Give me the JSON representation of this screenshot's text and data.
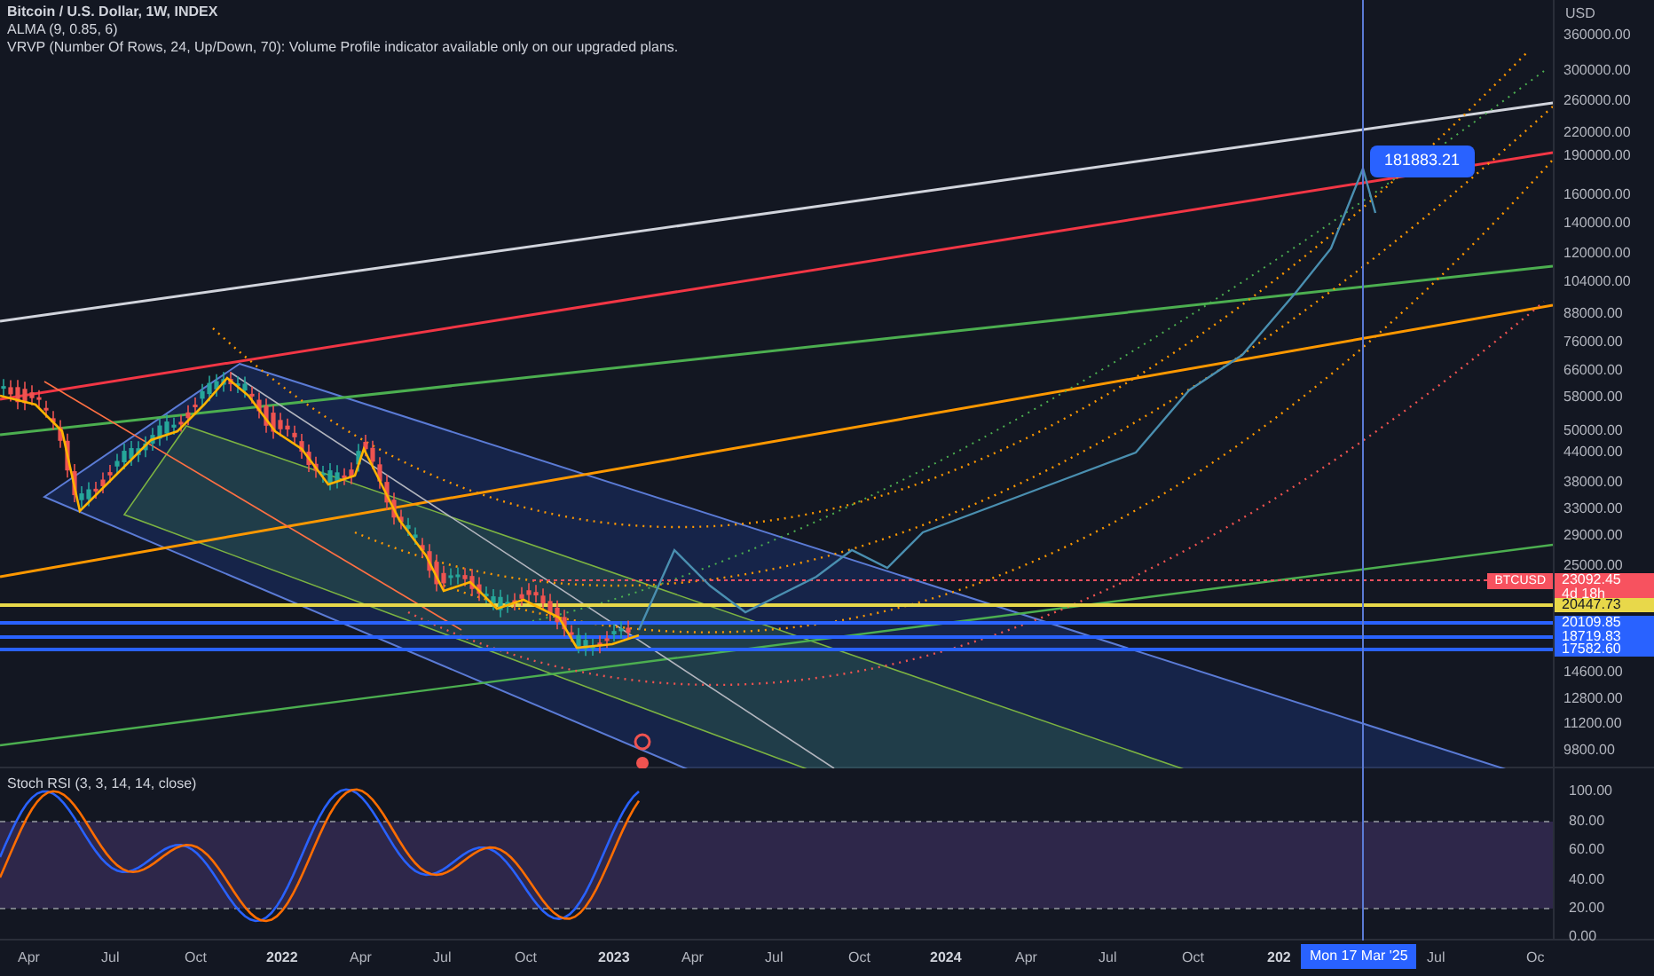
{
  "legend": {
    "symbol": "Bitcoin / U.S. Dollar, 1W, INDEX",
    "indicators": [
      "ALMA (9, 0.85, 6)",
      "VRVP (Number Of Rows, 24, Up/Down, 70): Volume Profile indicator available only on our upgraded plans."
    ]
  },
  "price_axis": {
    "currency": "USD",
    "ticks": [
      "360000.00",
      "300000.00",
      "260000.00",
      "220000.00",
      "190000.00",
      "160000.00",
      "140000.00",
      "120000.00",
      "104000.00",
      "88000.00",
      "76000.00",
      "66000.00",
      "58000.00",
      "50000.00",
      "44000.00",
      "38000.00",
      "33000.00",
      "29000.00",
      "25000.00",
      "14600.00",
      "12800.00",
      "11200.00",
      "9800.00"
    ]
  },
  "price_tags": [
    {
      "kind": "last",
      "label": "BTCUSD",
      "value": "23092.45",
      "countdown": "4d 18h",
      "color": "#f7525f"
    },
    {
      "kind": "highlight",
      "value": "20447.73",
      "color": "#e8d84a"
    },
    {
      "kind": "level",
      "value": "20109.85",
      "color": "#2962ff"
    },
    {
      "kind": "level",
      "value": "18719.83",
      "color": "#2962ff"
    },
    {
      "kind": "level",
      "value": "17582.60",
      "color": "#2962ff"
    }
  ],
  "crosshair": {
    "price": "181883.21",
    "date": "Mon 17 Mar '25"
  },
  "stoch_rsi": {
    "title": "Stoch RSI (3, 3, 14, 14, close)",
    "ticks": [
      "100.00",
      "80.00",
      "60.00",
      "40.00",
      "20.00",
      "0.00"
    ]
  },
  "time_axis": {
    "labels": [
      {
        "text": "Apr",
        "kind": "month"
      },
      {
        "text": "Jul",
        "kind": "month"
      },
      {
        "text": "Oct",
        "kind": "month"
      },
      {
        "text": "2022",
        "kind": "year"
      },
      {
        "text": "Apr",
        "kind": "month"
      },
      {
        "text": "Jul",
        "kind": "month"
      },
      {
        "text": "Oct",
        "kind": "month"
      },
      {
        "text": "2023",
        "kind": "year"
      },
      {
        "text": "Apr",
        "kind": "month"
      },
      {
        "text": "Jul",
        "kind": "month"
      },
      {
        "text": "Oct",
        "kind": "month"
      },
      {
        "text": "2024",
        "kind": "year"
      },
      {
        "text": "Apr",
        "kind": "month"
      },
      {
        "text": "Jul",
        "kind": "month"
      },
      {
        "text": "Oct",
        "kind": "month"
      },
      {
        "text": "202",
        "kind": "year"
      },
      {
        "text": "Jul",
        "kind": "month"
      },
      {
        "text": "Oc",
        "kind": "month"
      }
    ]
  }
}
